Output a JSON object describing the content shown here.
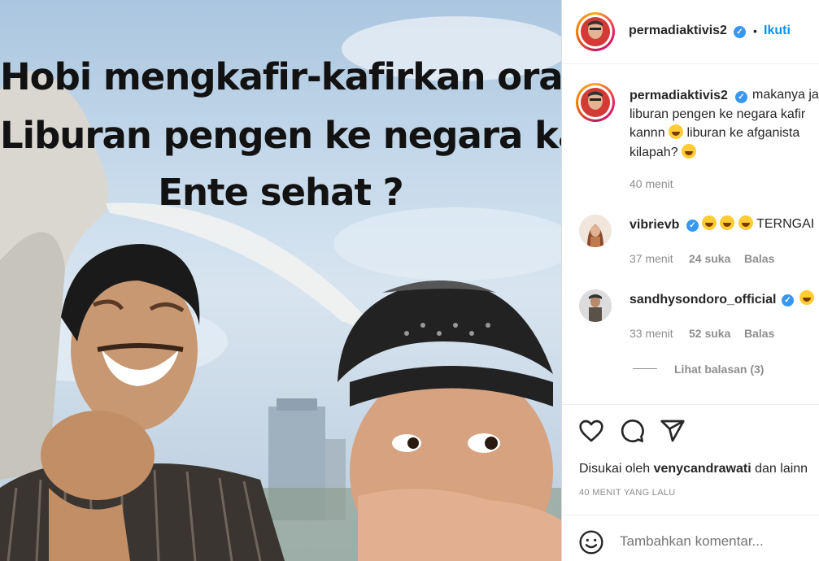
{
  "meme": {
    "line1": "Hobi mengkafir-kafirkan orang",
    "line2": "Liburan pengen ke negara kafir",
    "line3": "Ente sehat ?"
  },
  "header": {
    "username": "permadiaktivis2",
    "dot": "•",
    "follow_label": "Ikuti"
  },
  "caption": {
    "username": "permadiaktivis2",
    "line1": "makanya ja",
    "line2": "liburan pengen ke negara kafir",
    "line3a": "kannn",
    "line3b": "liburan ke afganista",
    "line4": "kilapah?",
    "time": "40 menit"
  },
  "comments": [
    {
      "username": "vibrievb",
      "text": "TERNGAI",
      "time": "37 menit",
      "likes": "24 suka",
      "reply": "Balas"
    },
    {
      "username": "sandhysondoro_official",
      "time": "33 menit",
      "likes": "52 suka",
      "reply": "Balas"
    }
  ],
  "view_replies": "Lihat balasan (3)",
  "likes": {
    "prefix": "Disukai oleh",
    "user": "venycandrawati",
    "suffix": "dan lainn"
  },
  "timestamp": "40 MENIT YANG LALU",
  "add_comment": {
    "placeholder": "Tambahkan komentar..."
  },
  "colors": {
    "link": "#0095f6",
    "verified": "#3897f0",
    "muted": "#8e8e8e"
  }
}
